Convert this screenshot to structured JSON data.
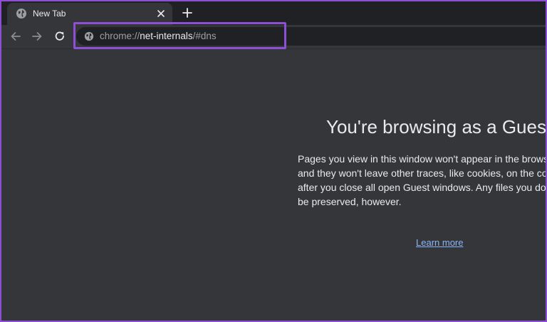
{
  "tab": {
    "title": "New Tab"
  },
  "omnibox": {
    "scheme": "chrome://",
    "host": "net-internals",
    "path": "/#dns"
  },
  "page": {
    "title": "You're browsing as a Guest",
    "body_lines": [
      "Pages you view in this window won't appear in the browser h",
      "and they won't leave other traces, like cookies, on the compu",
      "after you close all open Guest windows. Any files you downlo",
      "be preserved, however."
    ],
    "learn_more": "Learn more"
  },
  "colors": {
    "highlight_border": "#8e4fd6",
    "link": "#8ab4f8",
    "background": "#35363a",
    "tabstrip": "#202124"
  },
  "icons": {
    "tab_favicon": "globe-icon",
    "tab_close": "close-icon",
    "new_tab": "plus-icon",
    "back": "arrow-left-icon",
    "forward": "arrow-right-icon",
    "reload": "reload-icon",
    "site_info": "globe-icon"
  }
}
